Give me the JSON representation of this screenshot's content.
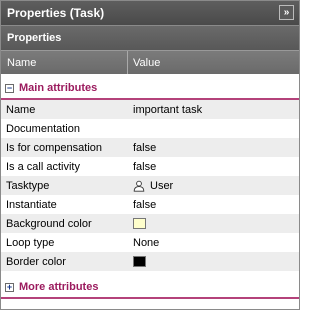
{
  "window": {
    "title": "Properties (Task)",
    "collapse_glyph": "»",
    "collapse_icon": "double-chevron-right-icon"
  },
  "panel": {
    "header": "Properties"
  },
  "columns": {
    "name": "Name",
    "value": "Value"
  },
  "sections": {
    "main": {
      "toggle": "−",
      "label": "Main attributes",
      "icon": "collapse-minus-icon"
    },
    "more": {
      "toggle": "+",
      "label": "More attributes",
      "icon": "expand-plus-icon"
    }
  },
  "rows": [
    {
      "name": "Name",
      "value": "important task"
    },
    {
      "name": "Documentation",
      "value": ""
    },
    {
      "name": "Is for compensation",
      "value": "false"
    },
    {
      "name": "Is a call activity",
      "value": "false"
    },
    {
      "name": "Tasktype",
      "value": "User",
      "icon": "user-icon"
    },
    {
      "name": "Instantiate",
      "value": "false"
    },
    {
      "name": "Background color",
      "color": "#ffffcc"
    },
    {
      "name": "Loop type",
      "value": "None"
    },
    {
      "name": "Border color",
      "color": "#000000"
    }
  ],
  "colors": {
    "accent": "#9b1b5e",
    "titlebar": "#4f4f4f"
  }
}
